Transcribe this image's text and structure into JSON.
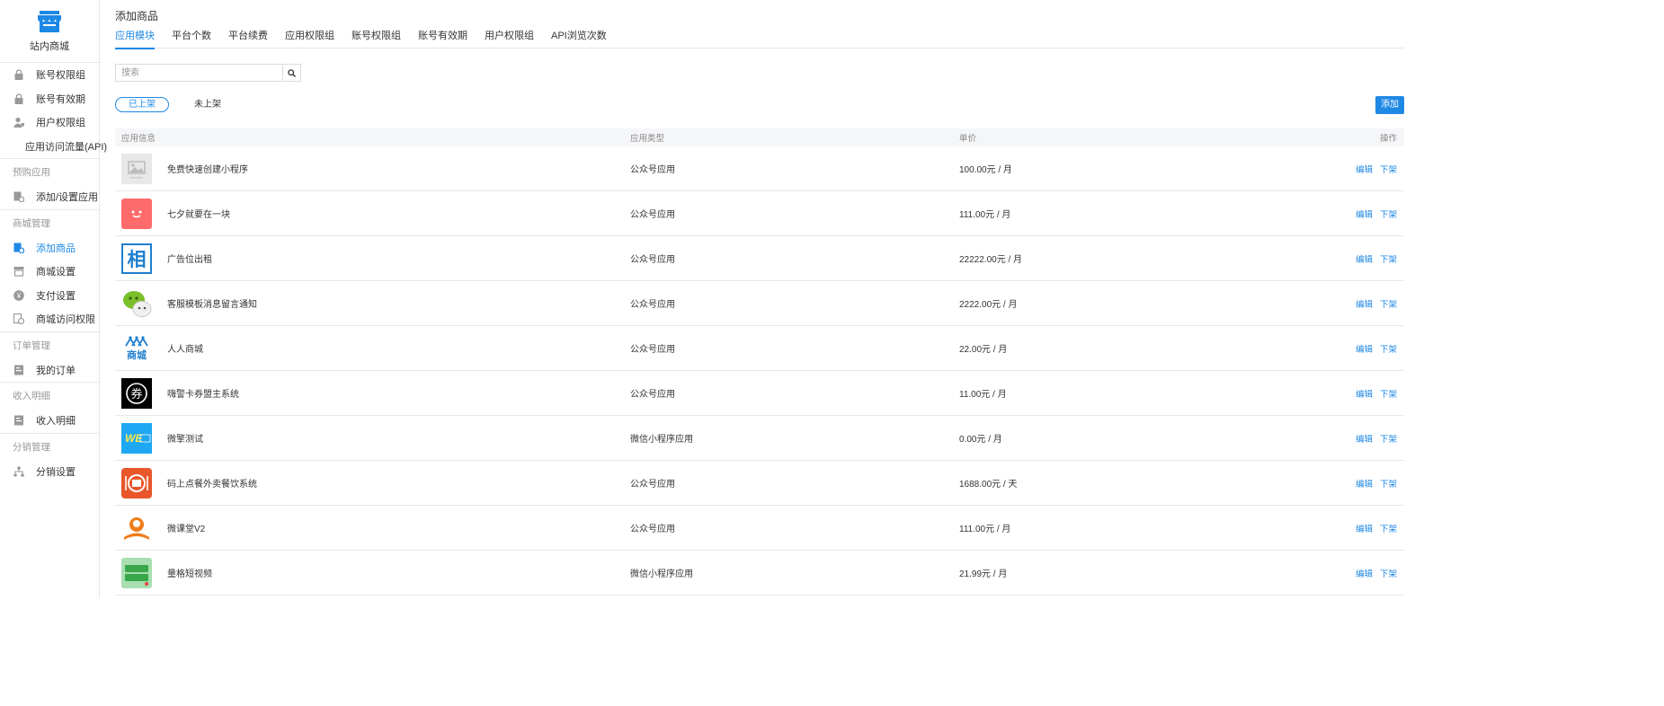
{
  "sidebar": {
    "brand": "站内商城",
    "items_top": [
      {
        "label": "账号权限组",
        "icon": "lock-icon"
      },
      {
        "label": "账号有效期",
        "icon": "lock-icon"
      },
      {
        "label": "用户权限组",
        "icon": "user-icon"
      },
      {
        "label": "应用访问流量(API)",
        "icon": "p-coin-icon"
      }
    ],
    "groups": [
      {
        "title": "预购应用",
        "items": [
          {
            "label": "添加/设置应用",
            "icon": "app-setting-icon"
          }
        ]
      },
      {
        "title": "商城管理",
        "items": [
          {
            "label": "添加商品",
            "icon": "add-goods-icon",
            "active": true
          },
          {
            "label": "商城设置",
            "icon": "store-icon"
          },
          {
            "label": "支付设置",
            "icon": "yen-icon"
          },
          {
            "label": "商城访问权限",
            "icon": "access-icon"
          }
        ]
      },
      {
        "title": "订单管理",
        "items": [
          {
            "label": "我的订单",
            "icon": "order-icon"
          }
        ]
      },
      {
        "title": "收入明细",
        "items": [
          {
            "label": "收入明细",
            "icon": "order-icon"
          }
        ]
      },
      {
        "title": "分销管理",
        "items": [
          {
            "label": "分销设置",
            "icon": "tree-icon"
          }
        ]
      }
    ]
  },
  "header": {
    "title": "添加商品",
    "tabs": [
      "应用模块",
      "平台个数",
      "平台续费",
      "应用权限组",
      "账号权限组",
      "账号有效期",
      "用户权限组",
      "API浏览次数"
    ],
    "active_tab": 0
  },
  "search": {
    "placeholder": "搜索"
  },
  "filters": {
    "on_shelf": "已上架",
    "off_shelf": "未上架"
  },
  "add_button": "添加",
  "table": {
    "headers": [
      "应用信息",
      "应用类型",
      "单价",
      "操作"
    ],
    "edit_label": "编辑",
    "remove_label": "下架",
    "rows": [
      {
        "name": "免费快速创建小程序",
        "type": "公众号应用",
        "price": "100.00元 / 月",
        "icon": "placeholder-image-icon"
      },
      {
        "name": "七夕就要在一块",
        "type": "公众号应用",
        "price": "111.00元 / 月",
        "icon": "smiley-icon"
      },
      {
        "name": "广告位出租",
        "type": "公众号应用",
        "price": "22222.00元 / 月",
        "icon": "xiang-character-icon"
      },
      {
        "name": "客服模板消息留言通知",
        "type": "公众号应用",
        "price": "2222.00元 / 月",
        "icon": "wechat-icon"
      },
      {
        "name": "人人商城",
        "type": "公众号应用",
        "price": "22.00元 / 月",
        "icon": "renren-mall-icon"
      },
      {
        "name": "嗨警卡券盟主系统",
        "type": "公众号应用",
        "price": "11.00元 / 月",
        "icon": "coupon-icon"
      },
      {
        "name": "微擎测试",
        "type": "微信小程序应用",
        "price": "0.00元 / 月",
        "icon": "we7-icon"
      },
      {
        "name": "码上点餐外卖餐饮系统",
        "type": "公众号应用",
        "price": "1688.00元 / 天",
        "icon": "food-order-icon"
      },
      {
        "name": "微课堂V2",
        "type": "公众号应用",
        "price": "111.00元 / 月",
        "icon": "classroom-icon"
      },
      {
        "name": "量格短视频",
        "type": "微信小程序应用",
        "price": "21.99元 / 月",
        "icon": "short-video-icon"
      }
    ]
  },
  "colors": {
    "accent": "#1e88e5",
    "border": "#e7e7eb",
    "header_bg": "#f5f6f8"
  }
}
